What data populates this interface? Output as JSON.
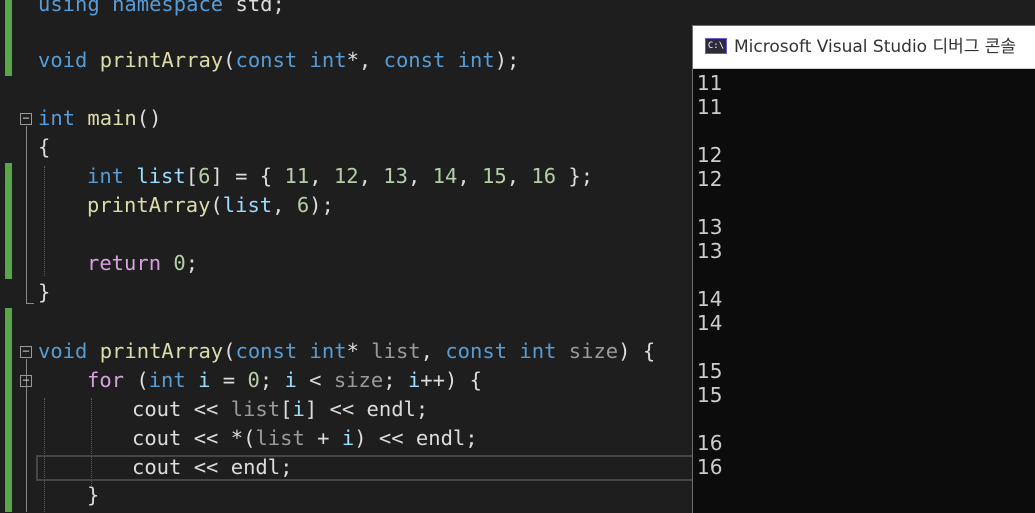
{
  "editor": {
    "lines": [
      {
        "id": "code-line-using",
        "tokens": [
          {
            "t": "using",
            "c": "kw"
          },
          {
            "t": " ",
            "c": "pl"
          },
          {
            "t": "namespace",
            "c": "kw"
          },
          {
            "t": " std;",
            "c": "pl"
          }
        ]
      },
      {
        "id": "code-line-prototype",
        "tokens": [
          {
            "t": "void",
            "c": "kw"
          },
          {
            "t": " ",
            "c": "pl"
          },
          {
            "t": "printArray",
            "c": "fn"
          },
          {
            "t": "(",
            "c": "pl"
          },
          {
            "t": "const",
            "c": "kw"
          },
          {
            "t": " ",
            "c": "pl"
          },
          {
            "t": "int",
            "c": "kw"
          },
          {
            "t": "*, ",
            "c": "pl"
          },
          {
            "t": "const",
            "c": "kw"
          },
          {
            "t": " ",
            "c": "pl"
          },
          {
            "t": "int",
            "c": "kw"
          },
          {
            "t": ");",
            "c": "pl"
          }
        ]
      },
      {
        "id": "code-line-main-signature",
        "tokens": [
          {
            "t": "int",
            "c": "kw"
          },
          {
            "t": " ",
            "c": "pl"
          },
          {
            "t": "main",
            "c": "fn"
          },
          {
            "t": "()",
            "c": "pl"
          }
        ]
      },
      {
        "id": "code-line-main-open-brace",
        "tokens": [
          {
            "t": "{",
            "c": "pl"
          }
        ]
      },
      {
        "id": "code-line-list-declaration",
        "tokens": [
          {
            "t": "int",
            "c": "kw"
          },
          {
            "t": " ",
            "c": "pl"
          },
          {
            "t": "list",
            "c": "var"
          },
          {
            "t": "[",
            "c": "pl"
          },
          {
            "t": "6",
            "c": "num"
          },
          {
            "t": "] = { ",
            "c": "pl"
          },
          {
            "t": "11",
            "c": "num"
          },
          {
            "t": ", ",
            "c": "pl"
          },
          {
            "t": "12",
            "c": "num"
          },
          {
            "t": ", ",
            "c": "pl"
          },
          {
            "t": "13",
            "c": "num"
          },
          {
            "t": ", ",
            "c": "pl"
          },
          {
            "t": "14",
            "c": "num"
          },
          {
            "t": ", ",
            "c": "pl"
          },
          {
            "t": "15",
            "c": "num"
          },
          {
            "t": ", ",
            "c": "pl"
          },
          {
            "t": "16",
            "c": "num"
          },
          {
            "t": " };",
            "c": "pl"
          }
        ]
      },
      {
        "id": "code-line-printarray-call",
        "tokens": [
          {
            "t": "printArray",
            "c": "fn"
          },
          {
            "t": "(",
            "c": "pl"
          },
          {
            "t": "list",
            "c": "var"
          },
          {
            "t": ", ",
            "c": "pl"
          },
          {
            "t": "6",
            "c": "num"
          },
          {
            "t": ");",
            "c": "pl"
          }
        ]
      },
      {
        "id": "code-line-return",
        "tokens": [
          {
            "t": "return",
            "c": "ctl"
          },
          {
            "t": " ",
            "c": "pl"
          },
          {
            "t": "0",
            "c": "num"
          },
          {
            "t": ";",
            "c": "pl"
          }
        ]
      },
      {
        "id": "code-line-main-close-brace",
        "tokens": [
          {
            "t": "}",
            "c": "pl"
          }
        ]
      },
      {
        "id": "code-line-printarray-definition",
        "tokens": [
          {
            "t": "void",
            "c": "kw"
          },
          {
            "t": " ",
            "c": "pl"
          },
          {
            "t": "printArray",
            "c": "fn"
          },
          {
            "t": "(",
            "c": "pl"
          },
          {
            "t": "const",
            "c": "kw"
          },
          {
            "t": " ",
            "c": "pl"
          },
          {
            "t": "int",
            "c": "kw"
          },
          {
            "t": "* ",
            "c": "pl"
          },
          {
            "t": "list",
            "c": "param"
          },
          {
            "t": ", ",
            "c": "pl"
          },
          {
            "t": "const",
            "c": "kw"
          },
          {
            "t": " ",
            "c": "pl"
          },
          {
            "t": "int",
            "c": "kw"
          },
          {
            "t": " ",
            "c": "pl"
          },
          {
            "t": "size",
            "c": "param"
          },
          {
            "t": ") {",
            "c": "pl"
          }
        ]
      },
      {
        "id": "code-line-for-loop",
        "tokens": [
          {
            "t": "for",
            "c": "ctl"
          },
          {
            "t": " (",
            "c": "pl"
          },
          {
            "t": "int",
            "c": "kw"
          },
          {
            "t": " ",
            "c": "pl"
          },
          {
            "t": "i",
            "c": "var"
          },
          {
            "t": " = ",
            "c": "pl"
          },
          {
            "t": "0",
            "c": "num"
          },
          {
            "t": "; ",
            "c": "pl"
          },
          {
            "t": "i",
            "c": "var"
          },
          {
            "t": " < ",
            "c": "pl"
          },
          {
            "t": "size",
            "c": "param"
          },
          {
            "t": "; ",
            "c": "pl"
          },
          {
            "t": "i",
            "c": "var"
          },
          {
            "t": "++) {",
            "c": "pl"
          }
        ]
      },
      {
        "id": "code-line-cout-index",
        "tokens": [
          {
            "t": "cout",
            "c": "pl"
          },
          {
            "t": " << ",
            "c": "pl"
          },
          {
            "t": "list",
            "c": "param"
          },
          {
            "t": "[",
            "c": "pl"
          },
          {
            "t": "i",
            "c": "var"
          },
          {
            "t": "] << ",
            "c": "pl"
          },
          {
            "t": "endl",
            "c": "pl"
          },
          {
            "t": ";",
            "c": "pl"
          }
        ]
      },
      {
        "id": "code-line-cout-pointer",
        "tokens": [
          {
            "t": "cout",
            "c": "pl"
          },
          {
            "t": " << *(",
            "c": "pl"
          },
          {
            "t": "list",
            "c": "param"
          },
          {
            "t": " + ",
            "c": "pl"
          },
          {
            "t": "i",
            "c": "var"
          },
          {
            "t": ") << ",
            "c": "pl"
          },
          {
            "t": "endl",
            "c": "pl"
          },
          {
            "t": ";",
            "c": "pl"
          }
        ]
      },
      {
        "id": "code-line-cout-endl",
        "tokens": [
          {
            "t": "cout",
            "c": "pl"
          },
          {
            "t": " << ",
            "c": "pl"
          },
          {
            "t": "endl",
            "c": "pl"
          },
          {
            "t": ";",
            "c": "pl"
          }
        ]
      },
      {
        "id": "code-line-for-close-brace",
        "tokens": [
          {
            "t": "}",
            "c": "pl"
          }
        ]
      }
    ]
  },
  "console": {
    "title": "Microsoft Visual Studio 디버그 콘솔",
    "icon_text": "C:\\",
    "output": [
      "11",
      "11",
      "",
      "12",
      "12",
      "",
      "13",
      "13",
      "",
      "14",
      "14",
      "",
      "15",
      "15",
      "",
      "16",
      "16"
    ]
  },
  "colors": {
    "editor_background": "#1e1e1e",
    "keyword": "#569cd6",
    "control_keyword": "#d8a0df",
    "function": "#dcdcaa",
    "number": "#b5cea8",
    "parameter": "#9a9a9a",
    "variable": "#9cdcfe",
    "plain_text": "#dcdcdc",
    "change_bar": "#57a64a",
    "console_background": "#0c0c0c"
  }
}
